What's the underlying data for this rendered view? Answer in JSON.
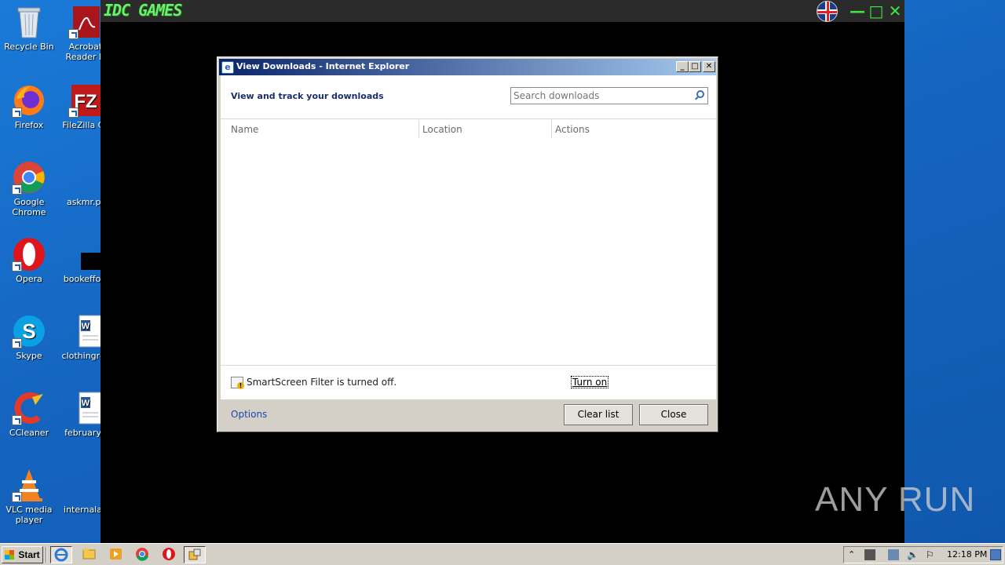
{
  "desktop": {
    "icons": [
      {
        "label": "Recycle Bin"
      },
      {
        "label": "Acrobat Reader D"
      },
      {
        "label": "Firefox"
      },
      {
        "label": "FileZilla Cli"
      },
      {
        "label": "Google Chrome"
      },
      {
        "label": "askmr.pr"
      },
      {
        "label": "Opera"
      },
      {
        "label": "bookeffort"
      },
      {
        "label": "Skype"
      },
      {
        "label": "clothingres"
      },
      {
        "label": "CCleaner"
      },
      {
        "label": "februaryn"
      },
      {
        "label": "VLC media player"
      },
      {
        "label": "internalan"
      }
    ]
  },
  "game": {
    "logo": "IDC GAMES",
    "minimize": "—",
    "maximize": "□",
    "close": "✕"
  },
  "dialog": {
    "title": "View Downloads - Internet Explorer",
    "heading": "View and track your downloads",
    "search_placeholder": "Search downloads",
    "columns": [
      "Name",
      "Location",
      "Actions"
    ],
    "smartscreen_text": "SmartScreen Filter is turned off.",
    "turn_on": "Turn on",
    "options": "Options",
    "clear_list": "Clear list",
    "close": "Close"
  },
  "taskbar": {
    "start": "Start",
    "clock": "12:18 PM"
  },
  "watermark": "ANY RUN"
}
